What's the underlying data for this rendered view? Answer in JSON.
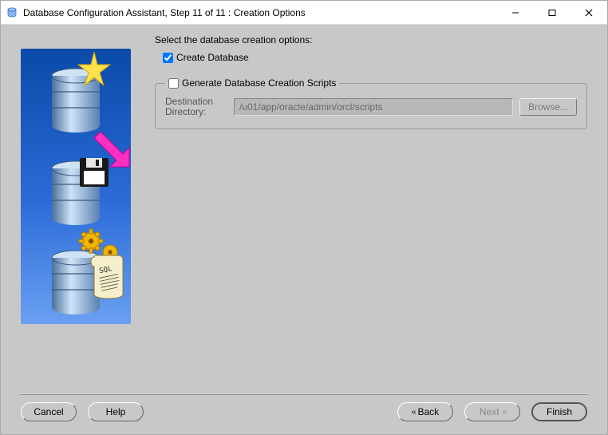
{
  "window": {
    "title": "Database Configuration Assistant, Step 11 of 11 : Creation Options"
  },
  "main": {
    "prompt": "Select the database creation options:",
    "create_db_label": "Create Database",
    "create_db_checked": true,
    "scripts": {
      "legend_label": "Generate Database Creation Scripts",
      "checked": false,
      "dest_label": "Destination Directory:",
      "dest_value": "/u01/app/oracle/admin/orcl/scripts",
      "browse_label": "Browse..."
    }
  },
  "buttons": {
    "cancel": "Cancel",
    "help": "Help",
    "back": "Back",
    "next": "Next",
    "finish": "Finish"
  }
}
